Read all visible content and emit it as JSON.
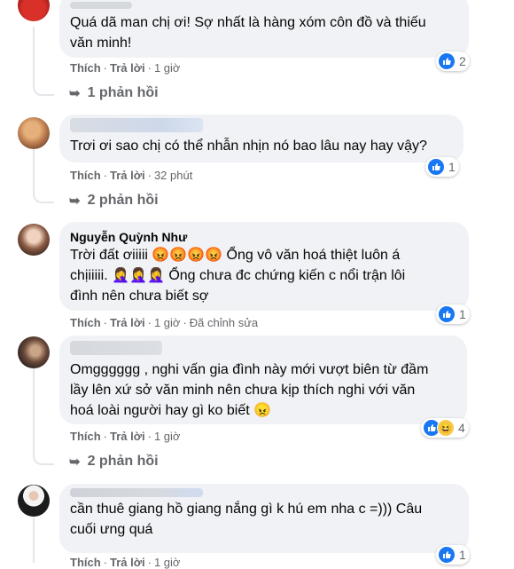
{
  "comments": [
    {
      "text_lines": [
        "Quá dã man chị ơi! Sợ nhất là hàng xóm côn đồ và thiếu",
        "văn minh!"
      ],
      "actions": {
        "like": "Thích",
        "reply": "Trả lời",
        "time": "1 giờ"
      },
      "reaction_count": "2",
      "replies_label": "1 phản hồi"
    },
    {
      "text_lines": [
        "Trơi ơi sao chị có thể nhẫn nhịn nó bao lâu nay hay vậy?"
      ],
      "actions": {
        "like": "Thích",
        "reply": "Trả lời",
        "time": "32 phút"
      },
      "reaction_count": "1",
      "replies_label": "2 phản hồi"
    },
    {
      "author": "Nguyễn Quỳnh Như",
      "text_lines": [
        "Trời đất ơiiiii 😡😡😡😡 Ổng vô văn hoá thiệt luôn á",
        "chịiiiii. 🤦‍♀️🤦‍♀️🤦‍♀️ Ổng chưa đc chứng kiến c nổi trận lôi",
        "đình nên chưa biết sợ"
      ],
      "actions": {
        "like": "Thích",
        "reply": "Trả lời",
        "time": "1 giờ",
        "edited": "Đã chỉnh sửa"
      },
      "reaction_count": "1"
    },
    {
      "text_lines": [
        "Omgggggg , nghi vấn gia đình này mới vượt biên từ đầm",
        "lầy lên xứ sở văn minh nên chưa kịp thích nghi với văn",
        "hoá loài người hay gì ko biết 😠"
      ],
      "actions": {
        "like": "Thích",
        "reply": "Trả lời",
        "time": "1 giờ"
      },
      "reaction_count": "4",
      "replies_label": "2 phản hồi"
    },
    {
      "text_lines": [
        "cần thuê giang hồ giang nắng gì k hú em nha c =))) Câu",
        "cuối ưng quá"
      ],
      "actions": {
        "like": "Thích",
        "reply": "Trả lời",
        "time": "1 giờ"
      },
      "reaction_count": "1"
    }
  ],
  "colors": {
    "like_blue": "#1877f2",
    "bubble_bg": "#f0f2f5",
    "meta_gray": "#65676b"
  }
}
